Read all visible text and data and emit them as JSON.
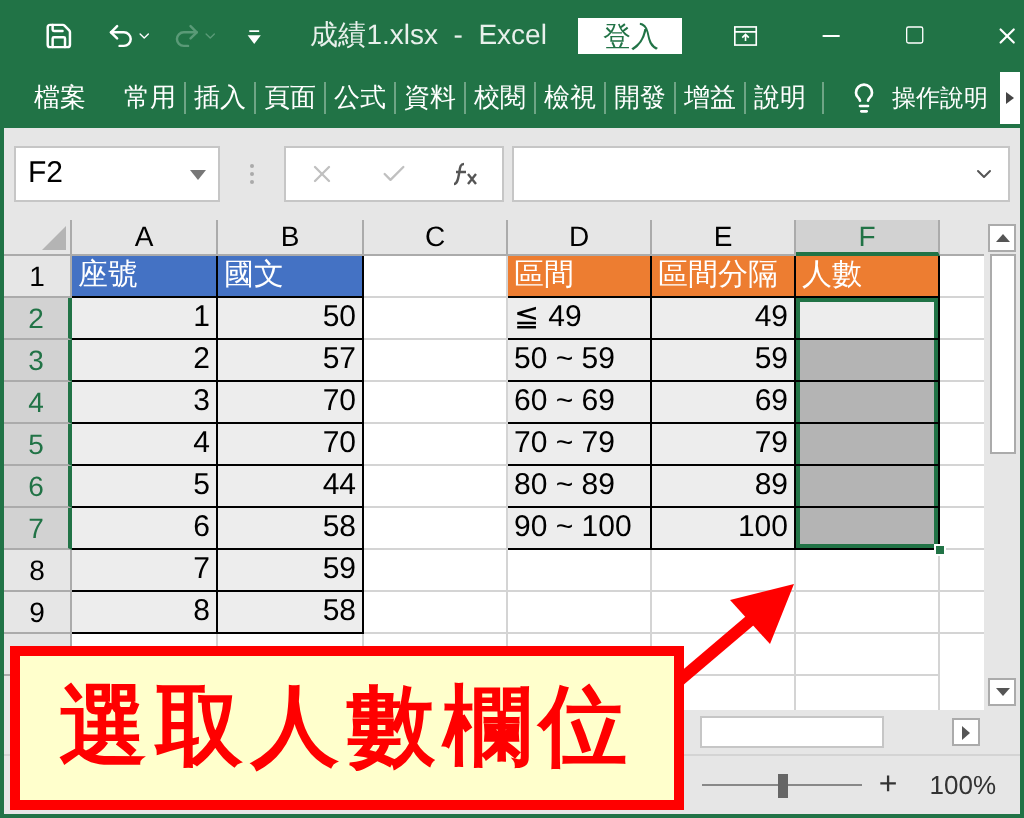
{
  "window": {
    "title": "成績1.xlsx  -  Excel",
    "sign_in": "登入"
  },
  "ribbon": {
    "tabs": [
      {
        "label": "檔案",
        "selected": false
      },
      {
        "label": "常用",
        "selected": false
      },
      {
        "label": "插入",
        "selected": false
      },
      {
        "label": "頁面",
        "selected": false
      },
      {
        "label": "公式",
        "selected": false
      },
      {
        "label": "資料",
        "selected": false
      },
      {
        "label": "校閱",
        "selected": false
      },
      {
        "label": "檢視",
        "selected": false
      },
      {
        "label": "開發",
        "selected": false
      },
      {
        "label": "增益",
        "selected": false
      },
      {
        "label": "說明",
        "selected": false
      }
    ],
    "tell_me": "操作說明"
  },
  "formula_bar": {
    "name_box": "F2"
  },
  "sheet": {
    "columns": [
      {
        "label": "A",
        "selected": false
      },
      {
        "label": "B",
        "selected": false
      },
      {
        "label": "C",
        "selected": false
      },
      {
        "label": "D",
        "selected": false
      },
      {
        "label": "E",
        "selected": false
      },
      {
        "label": "F",
        "selected": true
      }
    ],
    "rows": [
      {
        "number": "1",
        "selected": false,
        "cells": [
          {
            "text": "座號",
            "kind": "header",
            "color": "#4472c4",
            "selected": false
          },
          {
            "text": "國文",
            "kind": "header",
            "color": "#4472c4",
            "selected": false
          },
          {
            "kind": "empty",
            "selected": false
          },
          {
            "text": "區間",
            "kind": "header",
            "color": "#ed7d31",
            "selected": false
          },
          {
            "text": "區間分隔",
            "kind": "header",
            "color": "#ed7d31",
            "selected": false
          },
          {
            "text": "人數",
            "kind": "header",
            "color": "#ed7d31",
            "selected": false
          }
        ]
      },
      {
        "number": "2",
        "selected": true,
        "cells": [
          {
            "text": "1",
            "kind": "number",
            "selected": false
          },
          {
            "text": "50",
            "kind": "number",
            "selected": false
          },
          {
            "kind": "empty",
            "selected": false
          },
          {
            "text": "≦ 49",
            "kind": "label",
            "selected": false
          },
          {
            "text": "49",
            "kind": "number",
            "selected": false
          },
          {
            "kind": "number",
            "selected": true,
            "active": true
          }
        ]
      },
      {
        "number": "3",
        "selected": true,
        "cells": [
          {
            "text": "2",
            "kind": "number",
            "selected": false
          },
          {
            "text": "57",
            "kind": "number",
            "selected": false
          },
          {
            "kind": "empty",
            "selected": false
          },
          {
            "text": "50 ~ 59",
            "kind": "label",
            "selected": false
          },
          {
            "text": "59",
            "kind": "number",
            "selected": false
          },
          {
            "kind": "number",
            "selected": true,
            "active": false
          }
        ]
      },
      {
        "number": "4",
        "selected": true,
        "cells": [
          {
            "text": "3",
            "kind": "number",
            "selected": false
          },
          {
            "text": "70",
            "kind": "number",
            "selected": false
          },
          {
            "kind": "empty",
            "selected": false
          },
          {
            "text": "60 ~ 69",
            "kind": "label",
            "selected": false
          },
          {
            "text": "69",
            "kind": "number",
            "selected": false
          },
          {
            "kind": "number",
            "selected": true,
            "active": false
          }
        ]
      },
      {
        "number": "5",
        "selected": true,
        "cells": [
          {
            "text": "4",
            "kind": "number",
            "selected": false
          },
          {
            "text": "70",
            "kind": "number",
            "selected": false
          },
          {
            "kind": "empty",
            "selected": false
          },
          {
            "text": "70 ~ 79",
            "kind": "label",
            "selected": false
          },
          {
            "text": "79",
            "kind": "number",
            "selected": false
          },
          {
            "kind": "number",
            "selected": true,
            "active": false
          }
        ]
      },
      {
        "number": "6",
        "selected": true,
        "cells": [
          {
            "text": "5",
            "kind": "number",
            "selected": false
          },
          {
            "text": "44",
            "kind": "number",
            "selected": false
          },
          {
            "kind": "empty",
            "selected": false
          },
          {
            "text": "80 ~ 89",
            "kind": "label",
            "selected": false
          },
          {
            "text": "89",
            "kind": "number",
            "selected": false
          },
          {
            "kind": "number",
            "selected": true,
            "active": false
          }
        ]
      },
      {
        "number": "7",
        "selected": true,
        "cells": [
          {
            "text": "6",
            "kind": "number",
            "selected": false
          },
          {
            "text": "58",
            "kind": "number",
            "selected": false
          },
          {
            "kind": "empty",
            "selected": false
          },
          {
            "text": "90 ~ 100",
            "kind": "label",
            "selected": false
          },
          {
            "text": "100",
            "kind": "number",
            "selected": false
          },
          {
            "kind": "number",
            "selected": true,
            "active": false
          }
        ]
      },
      {
        "number": "8",
        "selected": false,
        "cells": [
          {
            "text": "7",
            "kind": "number",
            "selected": false
          },
          {
            "text": "59",
            "kind": "number",
            "selected": false
          },
          {
            "kind": "empty",
            "selected": false
          },
          {
            "kind": "empty",
            "selected": false
          },
          {
            "kind": "empty",
            "selected": false
          },
          {
            "kind": "empty",
            "selected": false
          }
        ]
      },
      {
        "number": "9",
        "selected": false,
        "cells": [
          {
            "text": "8",
            "kind": "number",
            "selected": false
          },
          {
            "text": "58",
            "kind": "number",
            "selected": false
          },
          {
            "kind": "empty",
            "selected": false
          },
          {
            "kind": "empty",
            "selected": false
          },
          {
            "kind": "empty",
            "selected": false
          },
          {
            "kind": "empty",
            "selected": false
          }
        ]
      }
    ]
  },
  "status_bar": {
    "zoom_in": "+",
    "zoom": "100%",
    "zoom_level": {
      "level": 0.5
    }
  },
  "callout": {
    "text": "選取人數欄位"
  }
}
